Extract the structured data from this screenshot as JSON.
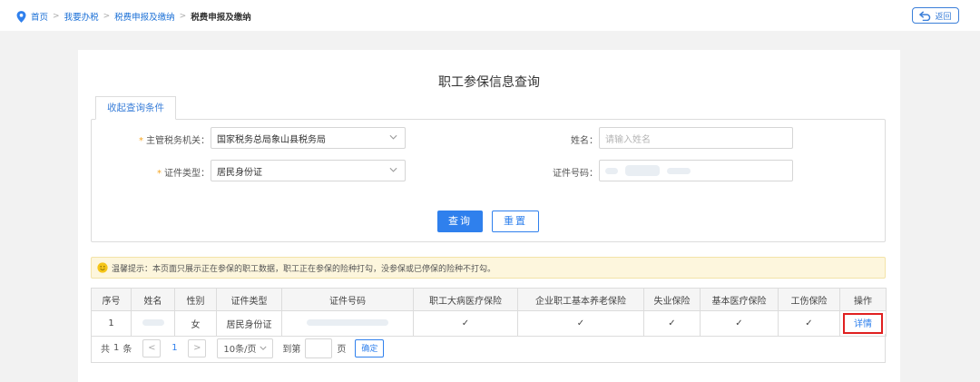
{
  "breadcrumb": {
    "items": [
      "首页",
      "我要办税",
      "税费申报及缴纳"
    ],
    "current": "税费申报及缴纳",
    "separator": ">"
  },
  "back_label": "返回",
  "title": "职工参保信息查询",
  "tab_label": "收起查询条件",
  "form": {
    "tax_office_label": "主管税务机关：",
    "tax_office_value": "国家税务总局象山县税务局",
    "name_label": "姓名：",
    "name_placeholder": "请输入姓名",
    "id_type_label": "证件类型：",
    "id_type_value": "居民身份证",
    "id_number_label": "证件号码：",
    "required_mark": "*"
  },
  "buttons": {
    "query": "查询",
    "reset": "重置"
  },
  "tip": "温馨提示：本页面只展示正在参保的职工数据，职工正在参保的险种打勾，没参保或已停保的险种不打勾。",
  "table": {
    "headers": [
      "序号",
      "姓名",
      "性别",
      "证件类型",
      "证件号码",
      "职工大病医疗保险",
      "企业职工基本养老保险",
      "失业保险",
      "基本医疗保险",
      "工伤保险",
      "操作"
    ],
    "rows": [
      {
        "index": "1",
        "gender": "女",
        "id_type": "居民身份证",
        "c1": "✓",
        "c2": "✓",
        "c3": "✓",
        "c4": "✓",
        "c5": "✓",
        "action": "详情"
      }
    ]
  },
  "pager": {
    "total_prefix": "共",
    "total": "1",
    "total_suffix": "条",
    "prev": "<",
    "page": "1",
    "next": ">",
    "page_size": "10条/页",
    "jump_prefix": "到第",
    "jump_suffix": "页",
    "confirm": "确定"
  },
  "colors": {
    "accent": "#2f80ed",
    "highlight_border": "#e02020",
    "tip_bg": "#fdf6dd"
  }
}
